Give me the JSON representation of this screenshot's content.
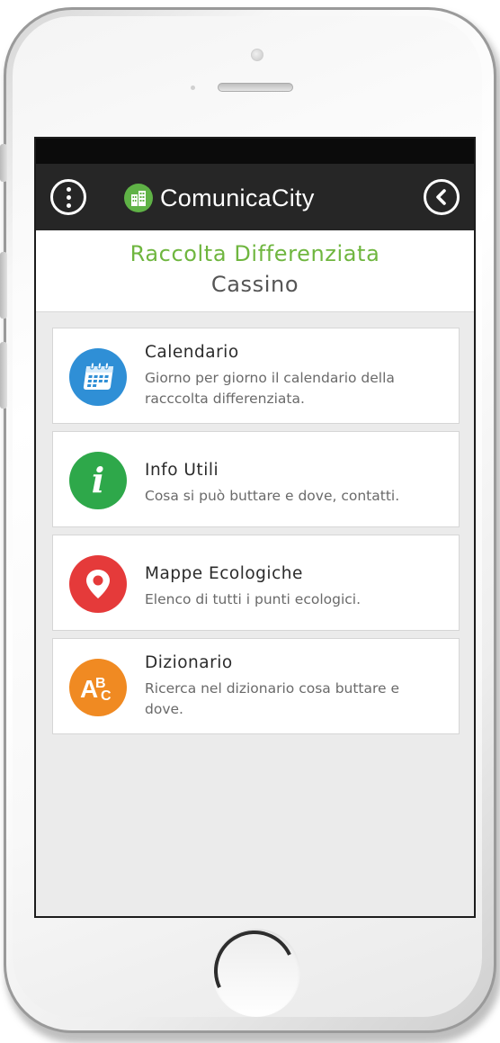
{
  "app": {
    "brand": "ComunicaCity",
    "colors": {
      "accent": "#6fb63f",
      "app_bar": "#262626",
      "background": "#ebebeb"
    }
  },
  "header": {
    "title": "Raccolta Differenziata",
    "city": "Cassino"
  },
  "menu": [
    {
      "label": "Calendario",
      "description": "Giorno per giorno il calendario della racccolta differenziata.",
      "icon": "calendar-icon",
      "color": "#2f8fd6"
    },
    {
      "label": "Info Utili",
      "description": "Cosa si può buttare e dove, contatti.",
      "icon": "info-icon",
      "color": "#2ea84a"
    },
    {
      "label": "Mappe Ecologiche",
      "description": "Elenco di tutti i punti ecologici.",
      "icon": "map-pin-icon",
      "color": "#e53a3a"
    },
    {
      "label": "Dizionario",
      "description": "Ricerca nel dizionario cosa buttare e dove.",
      "icon": "abc-icon",
      "color": "#f08a22"
    }
  ]
}
